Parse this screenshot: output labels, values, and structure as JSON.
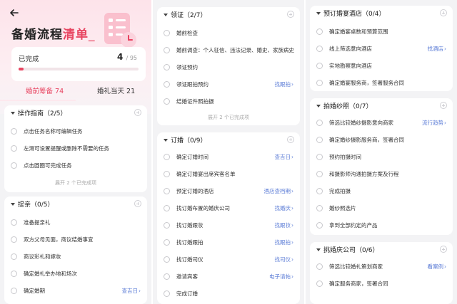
{
  "header": {
    "title_main": "备婚流程",
    "title_accent": "清单",
    "title_cursor": "_"
  },
  "progress": {
    "label": "已完成",
    "done": "4",
    "total": "/ 95",
    "fraction": 0.042
  },
  "tabs": [
    {
      "label": "婚前筹备 74",
      "active": true
    },
    {
      "label": "婚礼当天 21",
      "active": false
    }
  ],
  "colors": {
    "accent": "#e84561",
    "link": "#5a7bd6"
  },
  "column1": {
    "guide": {
      "title": "操作指南（2/5）",
      "items": [
        "点击任务名称可编辑任务",
        "左滑可设置提醒或删除不需要的任务",
        "点击圆圈可完成任务"
      ],
      "expand": "展开 2 个已完成项"
    },
    "proposal": {
      "title": "提亲（0/5）",
      "items": [
        {
          "label": "准备提亲礼",
          "link": ""
        },
        {
          "label": "双方父母见面，商议结婚事宜",
          "link": ""
        },
        {
          "label": "商议彩礼和嫁妆",
          "link": ""
        },
        {
          "label": "确定婚礼举办地和场次",
          "link": ""
        },
        {
          "label": "确定婚期",
          "link": "查吉日"
        }
      ]
    }
  },
  "column2": {
    "certificate": {
      "title": "领证（2/7）",
      "items": [
        {
          "label": "婚前检查",
          "link": ""
        },
        {
          "label": "婚前调查：个人征信、违法记录、婚史、家族病史",
          "link": ""
        },
        {
          "label": "领证预约",
          "link": ""
        },
        {
          "label": "领证跟拍预约",
          "link": "找跟拍"
        },
        {
          "label": "结婚证件照拍摄",
          "link": ""
        }
      ],
      "expand": "展开 2 个已完成项"
    },
    "booking": {
      "title": "订婚（0/9）",
      "items": [
        {
          "label": "确定订婚时间",
          "link": "查吉日"
        },
        {
          "label": "确定订婚宴出席宾客名单",
          "link": ""
        },
        {
          "label": "预定订婚的酒店",
          "link": "酒店查档期"
        },
        {
          "label": "找订婚布置的婚庆公司",
          "link": "找婚庆"
        },
        {
          "label": "找订婚跟妆",
          "link": "找跟妆"
        },
        {
          "label": "找订婚跟拍",
          "link": "找跟拍"
        },
        {
          "label": "找订婚司仪",
          "link": "找司仪"
        },
        {
          "label": "邀请宾客",
          "link": "电子请帖"
        },
        {
          "label": "完成订婚",
          "link": ""
        }
      ]
    }
  },
  "column3": {
    "hotel": {
      "title": "预订婚宴酒店（0/4）",
      "items": [
        {
          "label": "确定婚宴桌数和预算范围",
          "link": ""
        },
        {
          "label": "线上筛选意向酒店",
          "link": "找酒店"
        },
        {
          "label": "实地勘察意向酒店",
          "link": ""
        },
        {
          "label": "确定婚宴服务商，签署服务合同",
          "link": ""
        }
      ]
    },
    "photo": {
      "title": "拍婚纱照（0/7）",
      "items": [
        {
          "label": "筛选比较婚纱摄影意向商家",
          "link": "流行趋势"
        },
        {
          "label": "确定婚纱摄影服务商，签署合同",
          "link": ""
        },
        {
          "label": "预约拍摄时间",
          "link": ""
        },
        {
          "label": "和摄影师沟通拍摄方案及行程",
          "link": ""
        },
        {
          "label": "完成拍摄",
          "link": ""
        },
        {
          "label": "婚纱照选片",
          "link": ""
        },
        {
          "label": "拿到全部约定的产品",
          "link": ""
        }
      ]
    },
    "planner": {
      "title": "挑婚庆公司（0/6）",
      "items": [
        {
          "label": "筛选比较婚礼策划商家",
          "link": "看案例"
        },
        {
          "label": "确定服务商家，签署合同",
          "link": ""
        }
      ]
    }
  }
}
